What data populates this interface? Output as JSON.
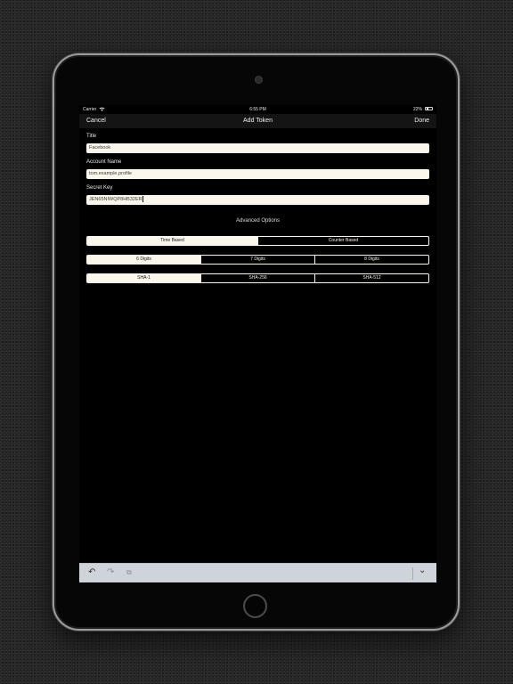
{
  "status_bar": {
    "carrier": "Carrier",
    "time": "6:55 PM",
    "battery": "22%"
  },
  "nav": {
    "cancel_label": "Cancel",
    "title": "Add Token",
    "done_label": "Done"
  },
  "form": {
    "title_label": "Title",
    "title_value": "Facebook",
    "account_label": "Account Name",
    "account_value": "tom.example.profile",
    "secret_label": "Secret Key",
    "secret_value": "JEN65NIWQP8HB32ER"
  },
  "advanced": {
    "header": "Advanced Options",
    "token_type": {
      "options": [
        "Time Based",
        "Counter Based"
      ],
      "selected": "Time Based"
    },
    "digits": {
      "options": [
        "6 Digits",
        "7 Digits",
        "8 Digits"
      ],
      "selected": "6 Digits"
    },
    "algorithm": {
      "options": [
        "SHA-1",
        "SHA-256",
        "SHA-512"
      ],
      "selected": "SHA-1"
    }
  },
  "keyboard_toolbar": {
    "undo_icon": "↶",
    "redo_icon": "↷",
    "paste_icon": "⧉",
    "dismiss_icon": "⌄"
  },
  "colors": {
    "field_background": "#fbf7ec",
    "nav_background": "#141414",
    "toolbar_background": "#cfd3da"
  }
}
